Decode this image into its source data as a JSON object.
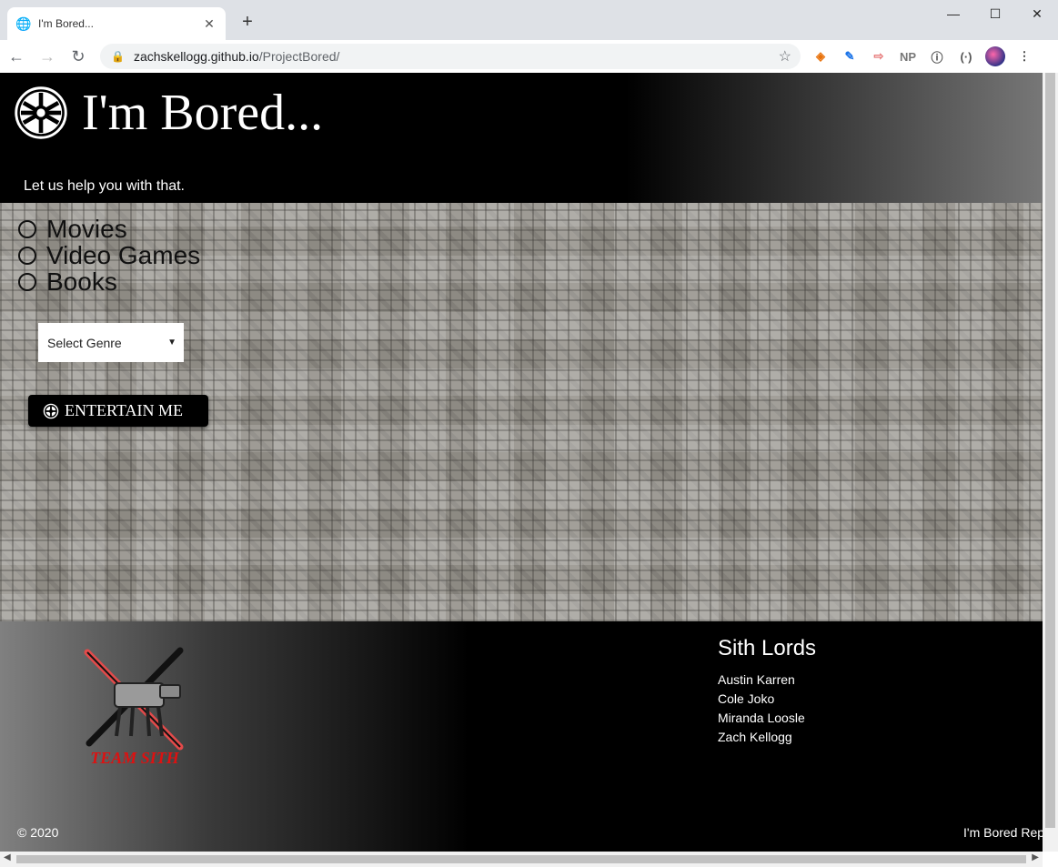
{
  "browser": {
    "tab_title": "I'm Bored...",
    "url_host": "zachskellogg.github.io",
    "url_path": "/ProjectBored/",
    "extensions": [
      "◈",
      "✎",
      "⇨",
      "NP",
      "ⓘ",
      "(·)"
    ]
  },
  "header": {
    "title": "I'm Bored...",
    "tagline": "Let us help you with that."
  },
  "categories": [
    "Movies",
    "Video Games",
    "Books"
  ],
  "genre_select": {
    "value": "Select Genre"
  },
  "entertain_button": {
    "label": "ENTERTAIN ME"
  },
  "footer": {
    "logo_text": "Team Sith",
    "team_heading": "Sith Lords",
    "members": [
      "Austin Karren",
      "Cole Joko",
      "Miranda Loosle",
      "Zach Kellogg"
    ],
    "copyright": "© 2020",
    "repo_link": "I'm Bored Repo"
  }
}
